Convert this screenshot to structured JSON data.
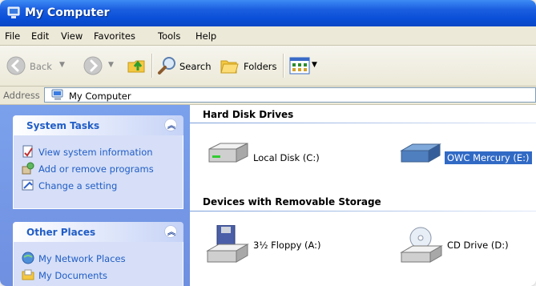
{
  "window": {
    "title": "My Computer"
  },
  "menu": [
    "File",
    "Edit",
    "View",
    "Favorites",
    "Tools",
    "Help"
  ],
  "toolbar": {
    "back": "Back",
    "search": "Search",
    "folders": "Folders"
  },
  "address": {
    "label": "Address",
    "value": "My Computer"
  },
  "system_tasks": {
    "title": "System Tasks",
    "items": [
      "View system information",
      "Add or remove programs",
      "Change a setting"
    ]
  },
  "other_places": {
    "title": "Other Places",
    "items": [
      "My Network Places",
      "My Documents"
    ]
  },
  "groups": {
    "hard_disks": {
      "title": "Hard Disk Drives",
      "items": [
        "Local Disk (C:)",
        "OWC Mercury (E:)"
      ]
    },
    "removable": {
      "title": "Devices with Removable Storage",
      "items": [
        "3½ Floppy (A:)",
        "CD Drive (D:)"
      ]
    }
  },
  "colors": {
    "titlebar": "#0a4fd8",
    "taskpane": "#7ba1ec",
    "link": "#215dc6",
    "selection": "#316ac5"
  }
}
